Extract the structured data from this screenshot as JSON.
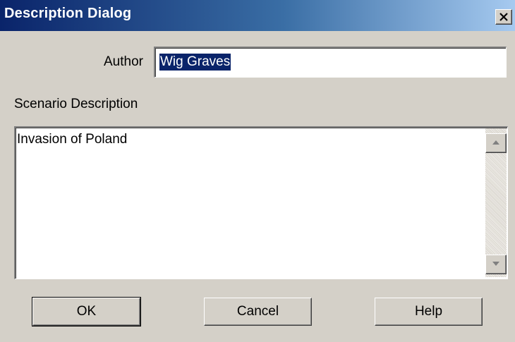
{
  "window": {
    "title": "Description Dialog",
    "title_color": "#0a246a"
  },
  "author": {
    "label": "Author",
    "value": "Wig Graves",
    "selected": true
  },
  "description": {
    "label": "Scenario Description",
    "value": "Invasion of Poland"
  },
  "buttons": {
    "ok": "OK",
    "cancel": "Cancel",
    "help": "Help"
  },
  "icons": {
    "close": "close-icon",
    "scroll_up": "scroll-up-arrow-icon",
    "scroll_down": "scroll-down-arrow-icon"
  }
}
